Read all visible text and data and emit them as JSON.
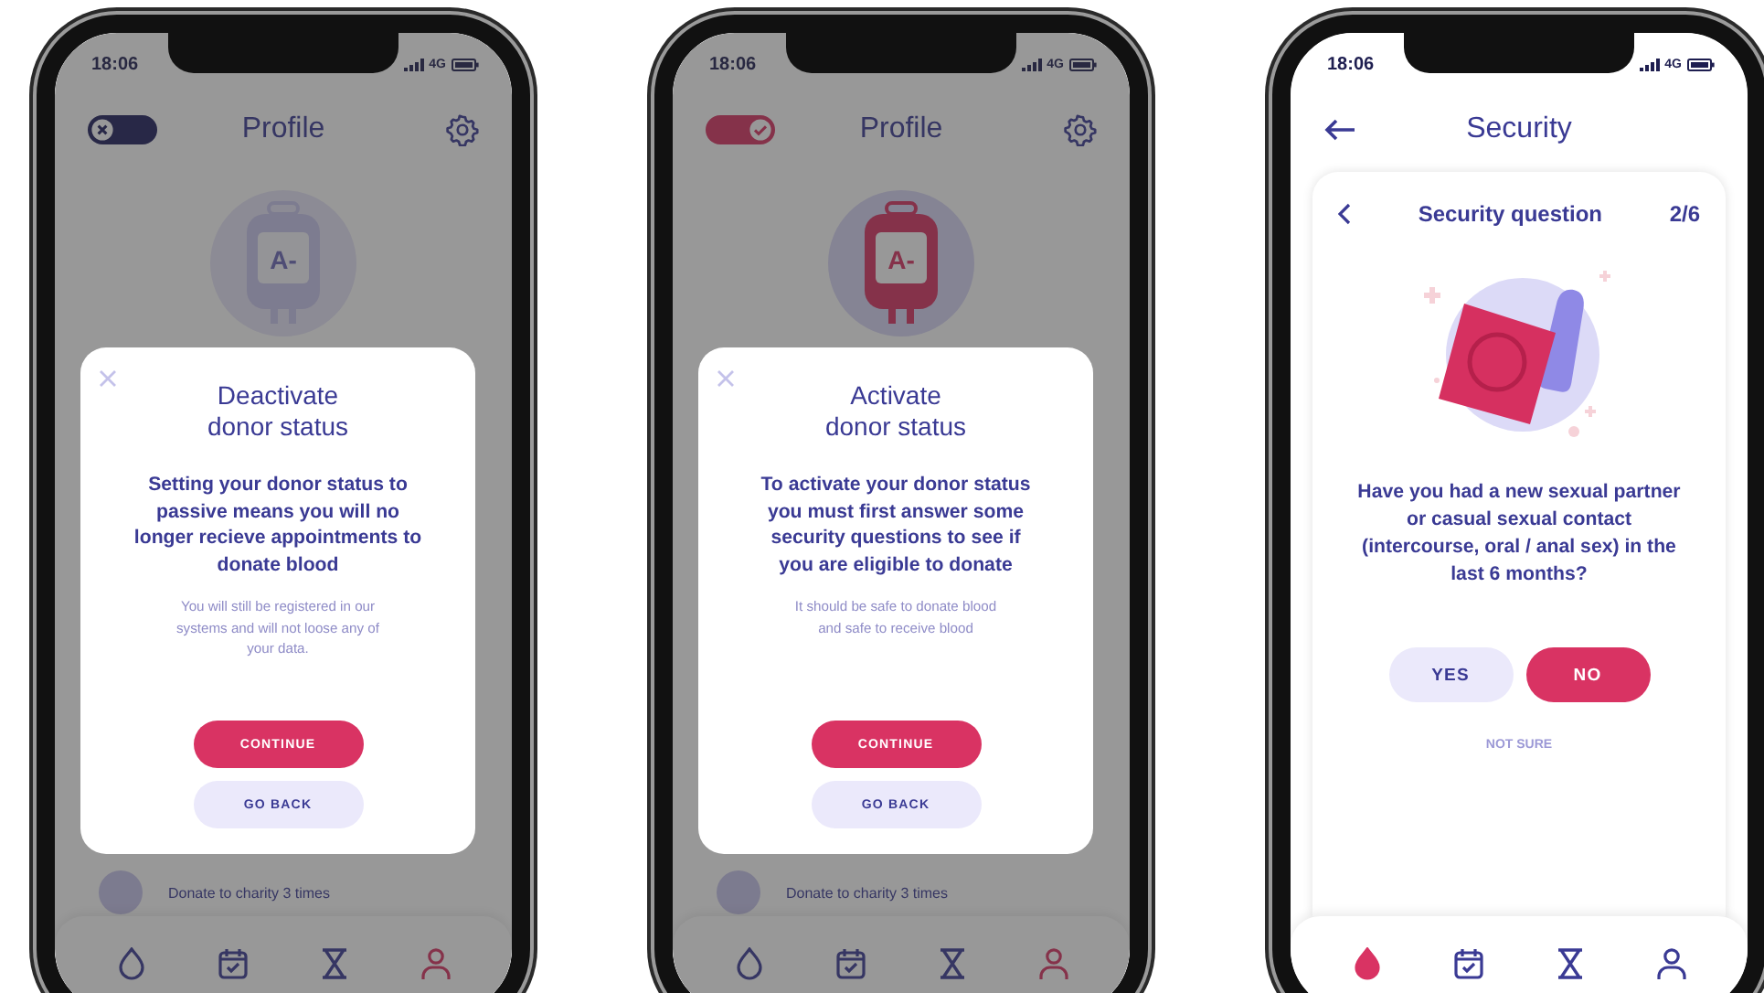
{
  "phones": [
    {
      "kind": "profile",
      "status": {
        "time": "18:06",
        "network": "4G"
      },
      "header": {
        "title": "Profile",
        "toggle_on": false
      },
      "blood_type": "A-",
      "behind_text": "Donate to charity 3 times",
      "dialog": {
        "title_lines": [
          "Deactivate",
          "donor status"
        ],
        "body": "Setting your donor status to passive means you will no longer recieve appointments to donate blood",
        "note": "You will still be registered in our systems and will not loose any of your data.",
        "buttons": [
          {
            "label": "CONTINUE",
            "kind": "primary"
          },
          {
            "label": "GO BACK",
            "kind": "secondary"
          }
        ]
      },
      "nav": [
        {
          "selected": false
        },
        {
          "selected": false
        },
        {
          "selected": false
        },
        {
          "selected": true
        }
      ]
    },
    {
      "kind": "profile",
      "status": {
        "time": "18:06",
        "network": "4G"
      },
      "header": {
        "title": "Profile",
        "toggle_on": true
      },
      "blood_type": "A-",
      "behind_text": "Donate to charity 3 times",
      "dialog": {
        "title_lines": [
          "Activate",
          "donor status"
        ],
        "body": "To activate your donor status you must first answer some security questions to see if you are eligible to donate",
        "note": "It should be safe to donate blood and safe to receive blood",
        "buttons": [
          {
            "label": "CONTINUE",
            "kind": "primary"
          },
          {
            "label": "GO BACK",
            "kind": "secondary"
          }
        ]
      },
      "nav": [
        {
          "selected": false
        },
        {
          "selected": false
        },
        {
          "selected": false
        },
        {
          "selected": true
        }
      ]
    },
    {
      "kind": "question",
      "status": {
        "time": "18:06",
        "network": "4G"
      },
      "header": {
        "title": "Security"
      },
      "card_title": "Security question",
      "progress": "2/6",
      "question": "Have you had a new sexual partner or casual sexual contact (intercourse, oral / anal sex) in the last 6 months?",
      "answers": [
        {
          "label": "YES",
          "selected": false
        },
        {
          "label": "NO",
          "selected": true
        }
      ],
      "not_sure": "NOT SURE",
      "nav": [
        {
          "selected": true
        },
        {
          "selected": false
        },
        {
          "selected": false
        },
        {
          "selected": false
        }
      ]
    }
  ]
}
